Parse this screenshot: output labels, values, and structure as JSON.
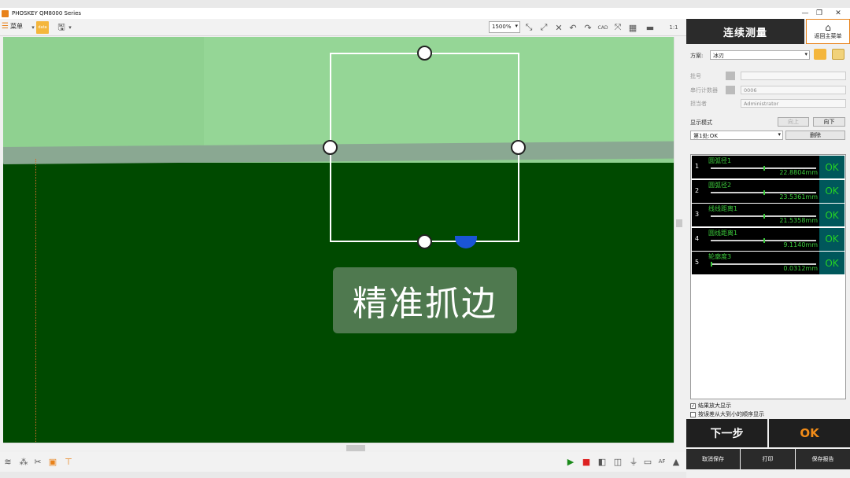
{
  "app": {
    "title": "PHOSKEY QM8000 Series"
  },
  "toolbar": {
    "menu_label": "菜单",
    "zoom_value": "1500%",
    "data_icon_label": "data"
  },
  "overlay": {
    "caption": "精准抓边"
  },
  "panel": {
    "header": "连续测量",
    "home_label": "返回主菜单",
    "plan_label": "方案:",
    "plan_value": "冰刃",
    "batch_label": "批号",
    "batch_value": "",
    "serial_label": "串行计数器",
    "serial_value": "0006",
    "owner_label": "担当者",
    "owner_value": "Administrator",
    "display_mode_label": "显示模式",
    "up_label": "向上",
    "down_label": "向下",
    "mode_value": "第1处:OK",
    "delete_label": "删除",
    "results": [
      {
        "index": "1",
        "name": "圆弧径1",
        "value": "22.8804mm",
        "status": "OK",
        "level": 0.5
      },
      {
        "index": "2",
        "name": "圆弧径2",
        "value": "23.5361mm",
        "status": "OK",
        "level": 0.5
      },
      {
        "index": "3",
        "name": "线线距离1",
        "value": "21.5358mm",
        "status": "OK",
        "level": 0.5
      },
      {
        "index": "4",
        "name": "圆线距离1",
        "value": "9.1140mm",
        "status": "OK",
        "level": 0.5
      },
      {
        "index": "5",
        "name": "轮廓度3",
        "value": "0.0312mm",
        "status": "OK",
        "level": 0.0
      }
    ],
    "check_zoom_label": "结果放大显示",
    "check_zoom_checked": true,
    "check_sort_label": "按误差从大到小的顺序显示",
    "check_sort_checked": false,
    "next_label": "下一步",
    "overall_status": "OK",
    "cancel_save_label": "取消保存",
    "print_label": "打印",
    "save_report_label": "保存报告"
  },
  "colors": {
    "accent": "#e8821a",
    "ok_green": "#25d125",
    "ok_bg": "#00575b",
    "image_dark": "#004a00",
    "image_light": "#8fd190"
  }
}
